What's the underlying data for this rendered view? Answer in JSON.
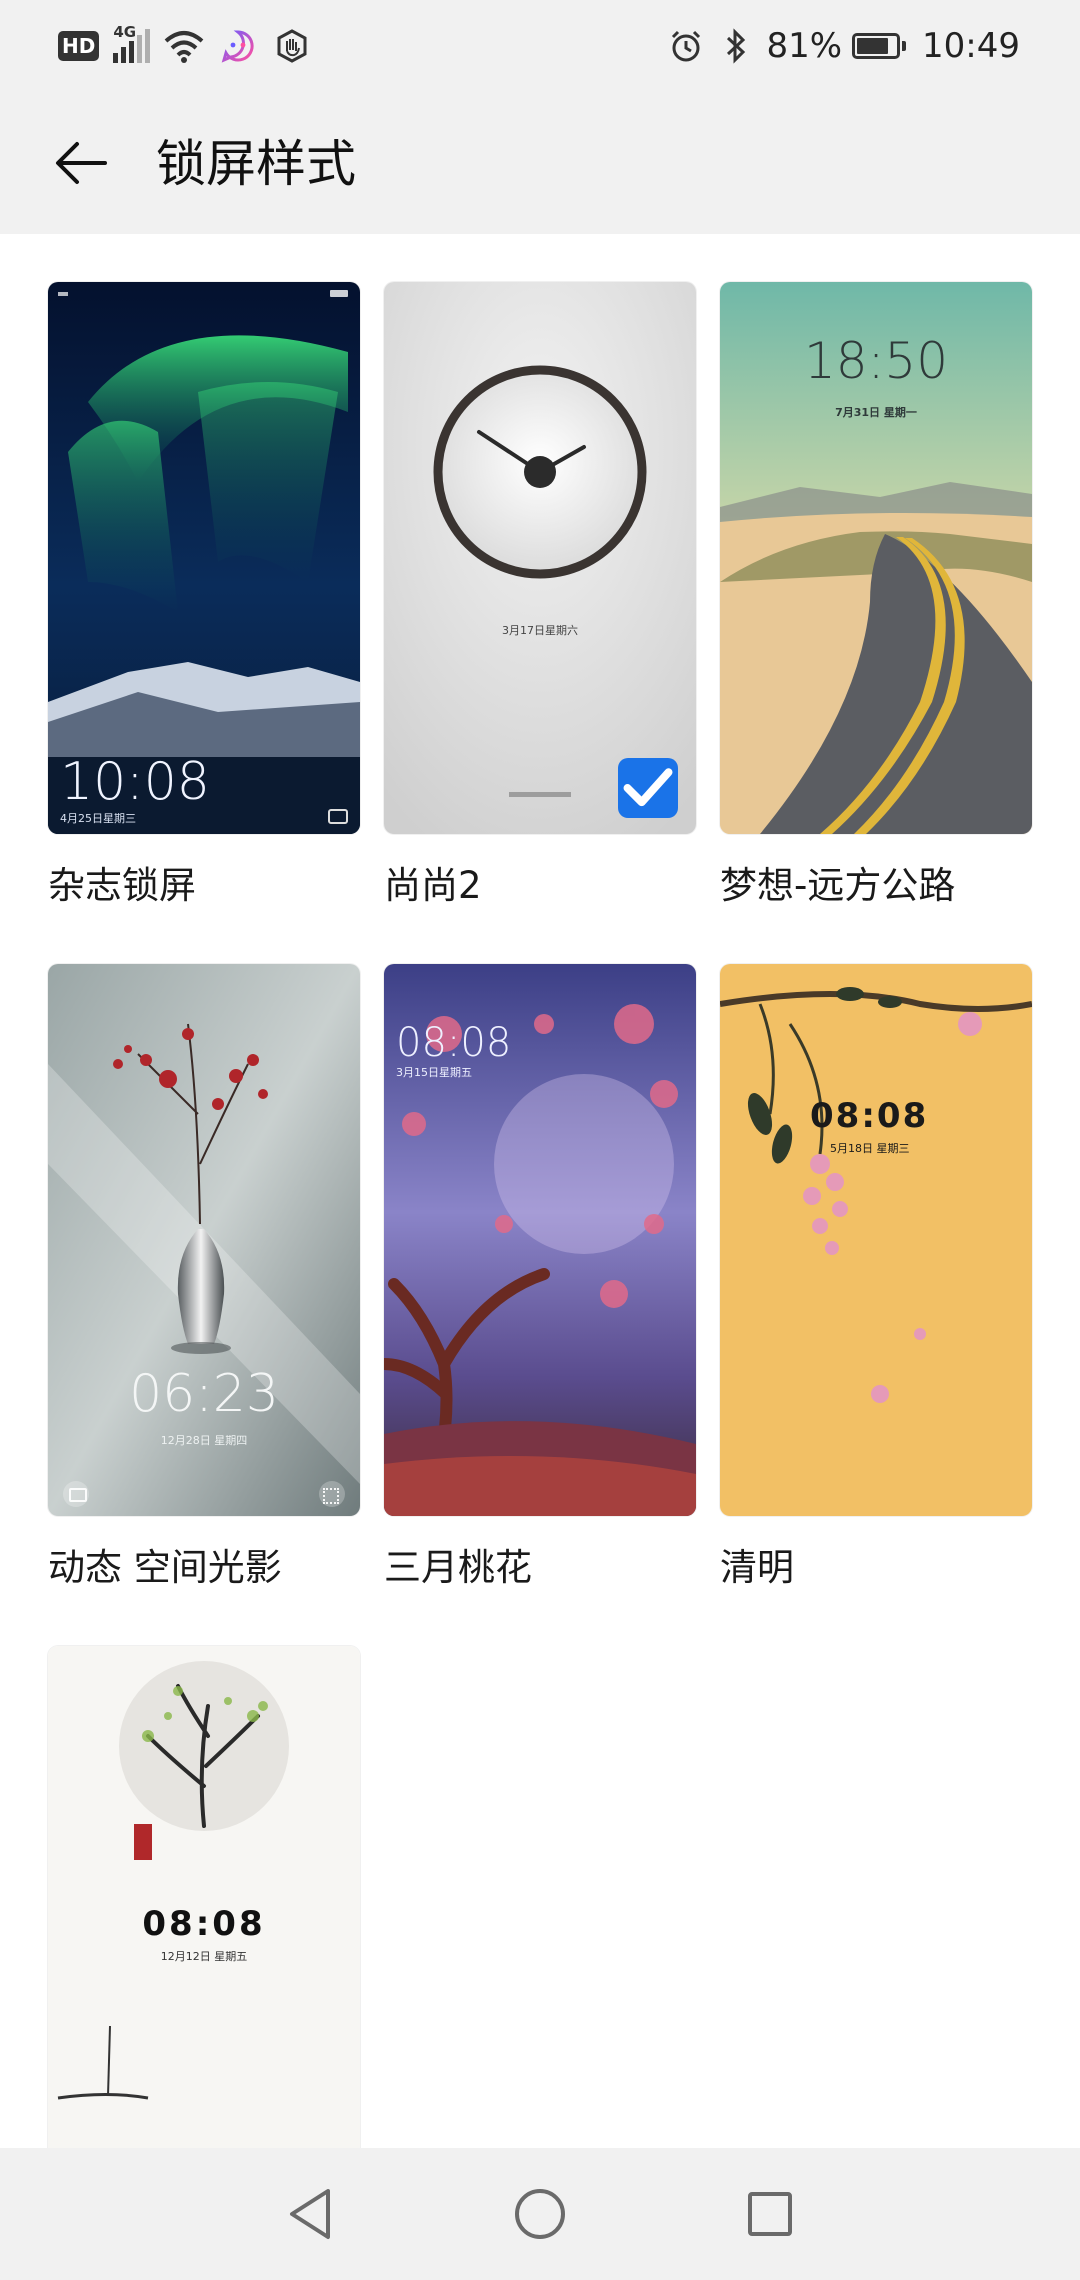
{
  "status_bar": {
    "hd": "HD",
    "network": "4G",
    "battery_percent": "81%",
    "battery_level": 0.81,
    "time": "10:49"
  },
  "title_bar": {
    "title": "锁屏样式"
  },
  "styles": [
    {
      "label": "杂志锁屏",
      "preview_time": "10:08",
      "preview_date": "4月25日星期三",
      "selected": false
    },
    {
      "label": "尚尚2",
      "preview_time": "",
      "preview_date": "3月17日星期六",
      "selected": true
    },
    {
      "label": "梦想-远方公路",
      "preview_time": "18:50",
      "preview_date": "7月31日 星期一",
      "selected": false
    },
    {
      "label": "动态 空间光影",
      "preview_time": "06:23",
      "preview_date": "12月28日 星期四",
      "selected": false
    },
    {
      "label": "三月桃花",
      "preview_time": "08:08",
      "preview_date": "3月15日星期五",
      "selected": false
    },
    {
      "label": "清明",
      "preview_time": "08:08",
      "preview_date": "5月18日 星期三",
      "selected": false
    },
    {
      "label": "",
      "preview_time": "08:08",
      "preview_date": "12月12日 星期五",
      "selected": false
    }
  ],
  "icons": {
    "back": "arrow-left-icon",
    "selected": "check-icon",
    "nav_back": "triangle-back-icon",
    "nav_home": "circle-home-icon",
    "nav_recents": "square-recents-icon"
  },
  "colors": {
    "accent": "#1a73e8",
    "bar_bg": "#f1f1f1"
  }
}
